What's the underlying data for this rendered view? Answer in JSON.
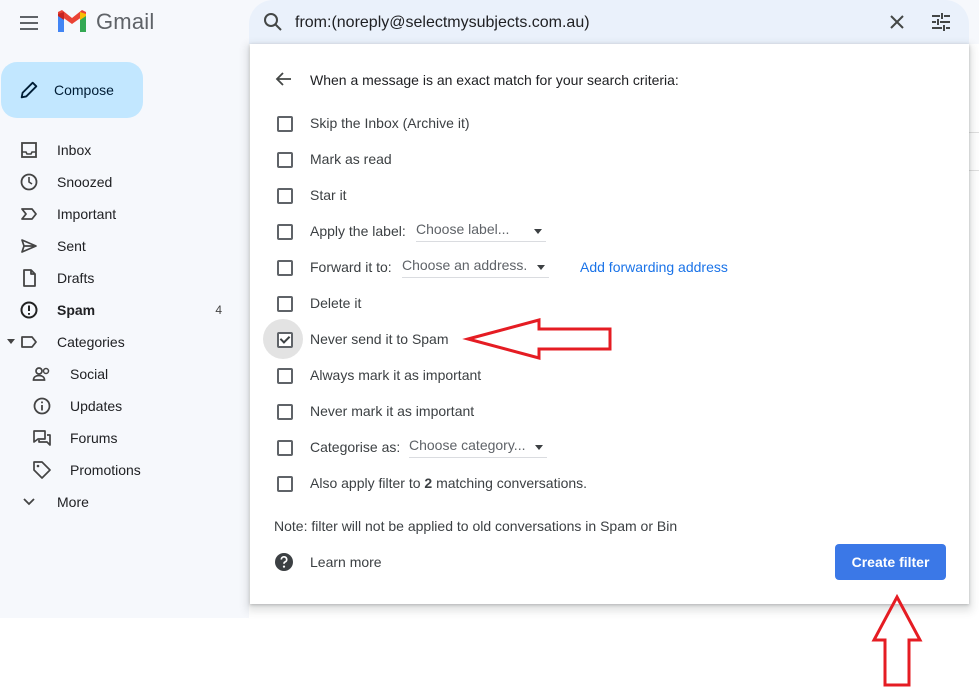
{
  "app": {
    "name": "Gmail",
    "colors": {
      "accent": "#3b78e7",
      "compose_bg": "#c2e7ff",
      "annotation": "#e51c23"
    }
  },
  "search": {
    "query": "from:(noreply@selectmysubjects.com.au)"
  },
  "compose_label": "Compose",
  "nav": {
    "inbox": "Inbox",
    "snoozed": "Snoozed",
    "important": "Important",
    "sent": "Sent",
    "drafts": "Drafts",
    "spam": "Spam",
    "spam_count": "4",
    "categories": "Categories",
    "social": "Social",
    "updates": "Updates",
    "forums": "Forums",
    "promotions": "Promotions",
    "more": "More"
  },
  "filter": {
    "title": "When a message is an exact match for your search criteria:",
    "options": [
      {
        "label": "Skip the Inbox (Archive it)",
        "checked": false
      },
      {
        "label": "Mark as read",
        "checked": false
      },
      {
        "label": "Star it",
        "checked": false
      },
      {
        "label": "Apply the label:",
        "checked": false,
        "dropdown": "Choose label..."
      },
      {
        "label": "Forward it to:",
        "checked": false,
        "dropdown": "Choose an address.",
        "link": "Add forwarding address"
      },
      {
        "label": "Delete it",
        "checked": false
      },
      {
        "label": "Never send it to Spam",
        "checked": true
      },
      {
        "label": "Always mark it as important",
        "checked": false
      },
      {
        "label": "Never mark it as important",
        "checked": false
      },
      {
        "label": "Categorise as:",
        "checked": false,
        "dropdown": "Choose category..."
      }
    ],
    "also_apply_prefix": "Also apply filter to ",
    "also_apply_count": "2",
    "also_apply_suffix": " matching conversations.",
    "note": "Note: filter will not be applied to old conversations in Spam or Bin",
    "learn_more": "Learn more",
    "create_button": "Create filter"
  }
}
